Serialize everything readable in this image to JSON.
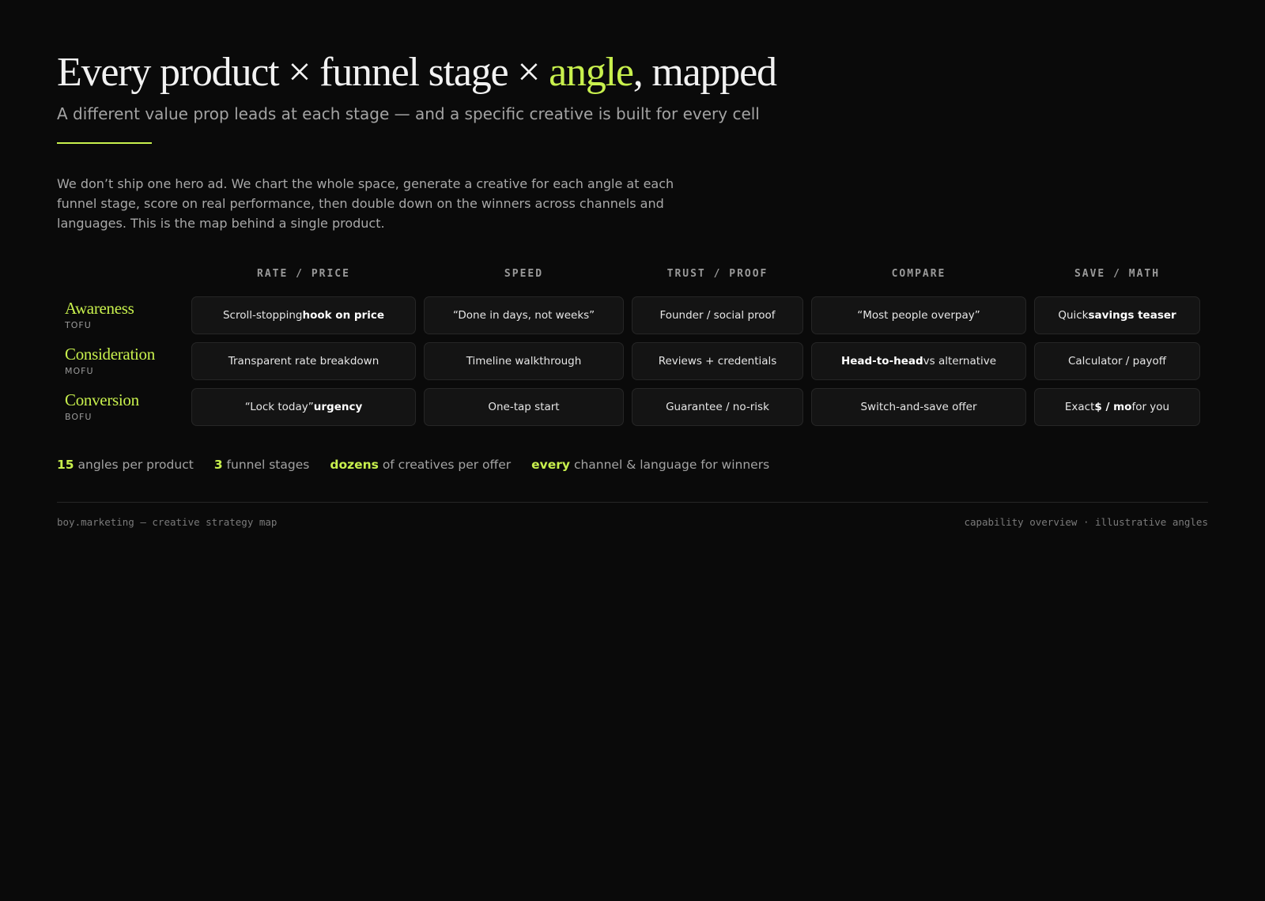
{
  "header": {
    "title_before": "Every product × funnel stage × ",
    "title_accent": "angle",
    "title_after": ", mapped",
    "subtitle": "A different value prop leads at each stage — and a specific creative is built for every cell"
  },
  "intro": "We don’t ship one hero ad. We chart the whole space, generate a creative for each angle at each funnel stage, score on real performance, then double down on the winners across channels and languages. This is the map behind a single product.",
  "matrix": {
    "columns": [
      "RATE / PRICE",
      "SPEED",
      "TRUST / PROOF",
      "COMPARE",
      "SAVE / MATH"
    ],
    "rows": [
      {
        "stage": "Awareness",
        "code": "TOFU",
        "cells": [
          {
            "pre": "Scroll-stopping ",
            "bold": "hook on price",
            "post": ""
          },
          {
            "pre": "“Done in days, not weeks”",
            "bold": "",
            "post": ""
          },
          {
            "pre": "Founder / social proof",
            "bold": "",
            "post": ""
          },
          {
            "pre": "“Most people overpay”",
            "bold": "",
            "post": ""
          },
          {
            "pre": "Quick ",
            "bold": "savings teaser",
            "post": ""
          }
        ]
      },
      {
        "stage": "Consideration",
        "code": "MOFU",
        "cells": [
          {
            "pre": "Transparent rate breakdown",
            "bold": "",
            "post": ""
          },
          {
            "pre": "Timeline walkthrough",
            "bold": "",
            "post": ""
          },
          {
            "pre": "Reviews + credentials",
            "bold": "",
            "post": ""
          },
          {
            "pre": "",
            "bold": "Head-to-head",
            "post": " vs alternative"
          },
          {
            "pre": "Calculator / payoff",
            "bold": "",
            "post": ""
          }
        ]
      },
      {
        "stage": "Conversion",
        "code": "BOFU",
        "cells": [
          {
            "pre": "“Lock today” ",
            "bold": "urgency",
            "post": ""
          },
          {
            "pre": "One-tap start",
            "bold": "",
            "post": ""
          },
          {
            "pre": "Guarantee / no-risk",
            "bold": "",
            "post": ""
          },
          {
            "pre": "Switch-and-save offer",
            "bold": "",
            "post": ""
          },
          {
            "pre": "Exact ",
            "bold": "$ / mo",
            "post": " for you"
          }
        ]
      }
    ]
  },
  "stats": [
    {
      "num": "15",
      "text": " angles per product"
    },
    {
      "num": "3",
      "text": " funnel stages"
    },
    {
      "num": "dozens",
      "text": " of creatives per offer"
    },
    {
      "num": "every",
      "text": " channel & language for winners"
    }
  ],
  "footer": {
    "left": "boy.marketing — creative strategy map",
    "right": "capability overview · illustrative angles"
  },
  "colors": {
    "background": "#0a0a0a",
    "accent": "#c8f04d",
    "cell_background": "#141414",
    "cell_border": "#262626"
  }
}
